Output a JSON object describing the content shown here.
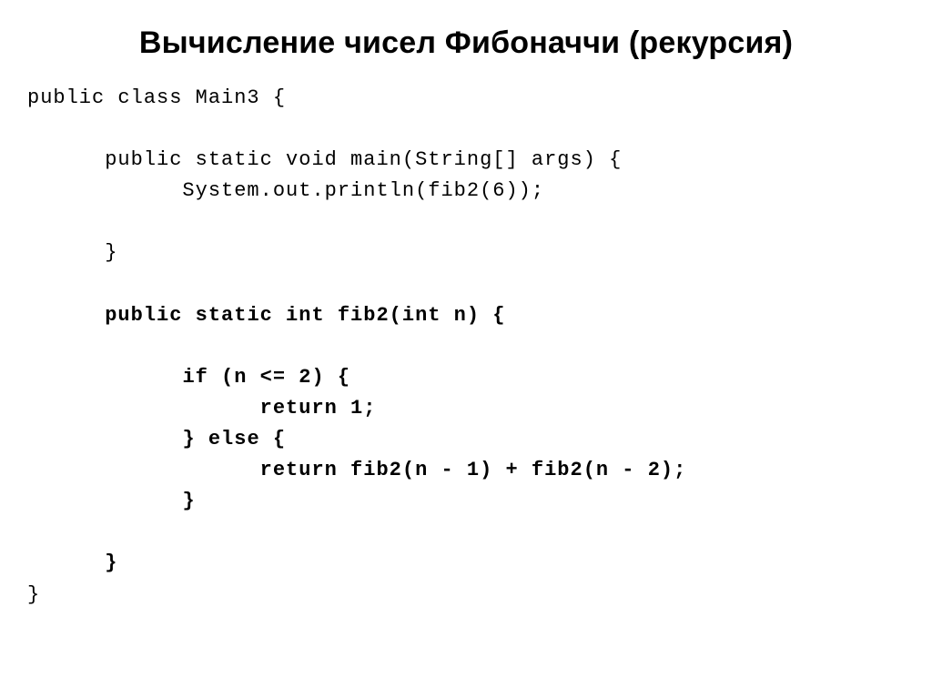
{
  "title": "Вычисление чисел Фибоначчи (рекурсия)",
  "code": {
    "l01": "public class Main3 {",
    "l02": "",
    "l03": "      public static void main(String[] args) {",
    "l04": "            System.out.println(fib2(6));",
    "l05": "",
    "l06": "      }",
    "l07": "",
    "l08a": "      ",
    "l08b": "public static int fib2(int n) {",
    "l09": "",
    "l10a": "            ",
    "l10b": "if (n <= 2) {",
    "l11a": "                  ",
    "l11b": "return 1;",
    "l12a": "            ",
    "l12b": "} else {",
    "l13a": "                  ",
    "l13b": "return fib2(n - 1) + fib2(n - 2);",
    "l14a": "            ",
    "l14b": "}",
    "l15": "",
    "l16a": "      ",
    "l16b": "}",
    "l17": "}"
  }
}
